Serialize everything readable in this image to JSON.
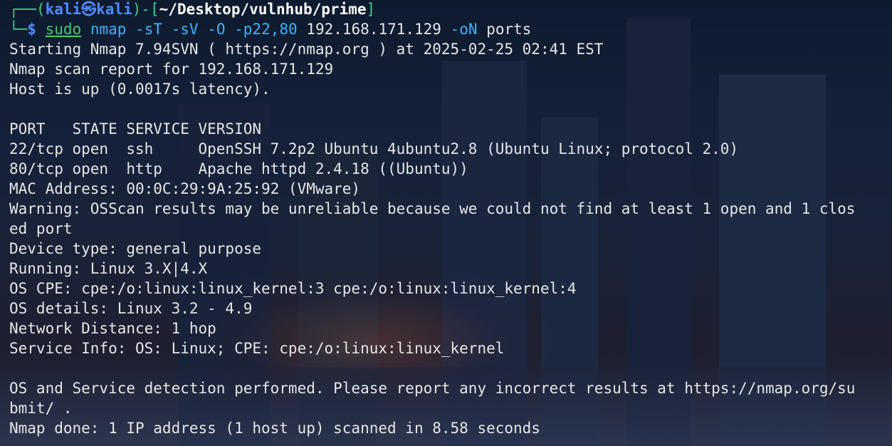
{
  "prompt": {
    "corner_top": "┌──(",
    "user": "kali",
    "at": "㉿",
    "host": "kali",
    "sep": ")-[",
    "path": "~/Desktop/vulnhub/prime",
    "close": "]",
    "corner_bottom": "└─",
    "dollar": "$ "
  },
  "command": {
    "sudo": "sudo",
    "prog": "nmap",
    "flags": "-sT -sV -O -p22,80",
    "target": "192.168.171.129",
    "output_flag": "-oN",
    "output_file": "ports"
  },
  "output": [
    "Starting Nmap 7.94SVN ( https://nmap.org ) at 2025-02-25 02:41 EST",
    "Nmap scan report for 192.168.171.129",
    "Host is up (0.0017s latency).",
    "",
    "PORT   STATE SERVICE VERSION",
    "22/tcp open  ssh     OpenSSH 7.2p2 Ubuntu 4ubuntu2.8 (Ubuntu Linux; protocol 2.0)",
    "80/tcp open  http    Apache httpd 2.4.18 ((Ubuntu))",
    "MAC Address: 00:0C:29:9A:25:92 (VMware)",
    "Warning: OSScan results may be unreliable because we could not find at least 1 open and 1 clos",
    "ed port",
    "Device type: general purpose",
    "Running: Linux 3.X|4.X",
    "OS CPE: cpe:/o:linux:linux_kernel:3 cpe:/o:linux:linux_kernel:4",
    "OS details: Linux 3.2 - 4.9",
    "Network Distance: 1 hop",
    "Service Info: OS: Linux; CPE: cpe:/o:linux:linux_kernel",
    "",
    "OS and Service detection performed. Please report any incorrect results at https://nmap.org/su",
    "bmit/ .",
    "Nmap done: 1 IP address (1 host up) scanned in 8.58 seconds"
  ]
}
